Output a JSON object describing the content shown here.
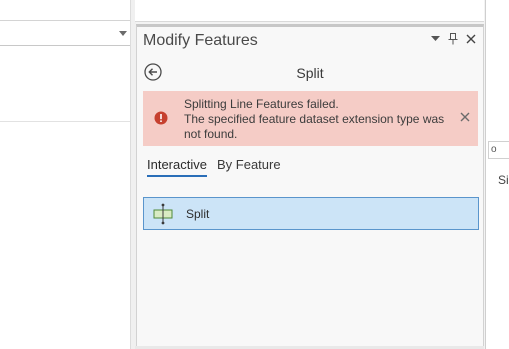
{
  "pane": {
    "title": "Modify Features",
    "section_title": "Split"
  },
  "error": {
    "line1": "Splitting Line Features failed.",
    "line2": "The specified feature dataset extension type was not found."
  },
  "tabs": [
    {
      "label": "Interactive",
      "active": true
    },
    {
      "label": "By Feature",
      "active": false
    }
  ],
  "tools": [
    {
      "label": "Split",
      "icon": "split-line-icon",
      "selected": true
    }
  ],
  "right_strip": {
    "field_text": "o",
    "label_text": "Siz"
  },
  "colors": {
    "error_bg": "#f5ccc6",
    "error_icon": "#c6402f",
    "selected_bg": "#cce4f7",
    "selected_border": "#5a95cc",
    "tab_underline": "#2a6eb8"
  }
}
